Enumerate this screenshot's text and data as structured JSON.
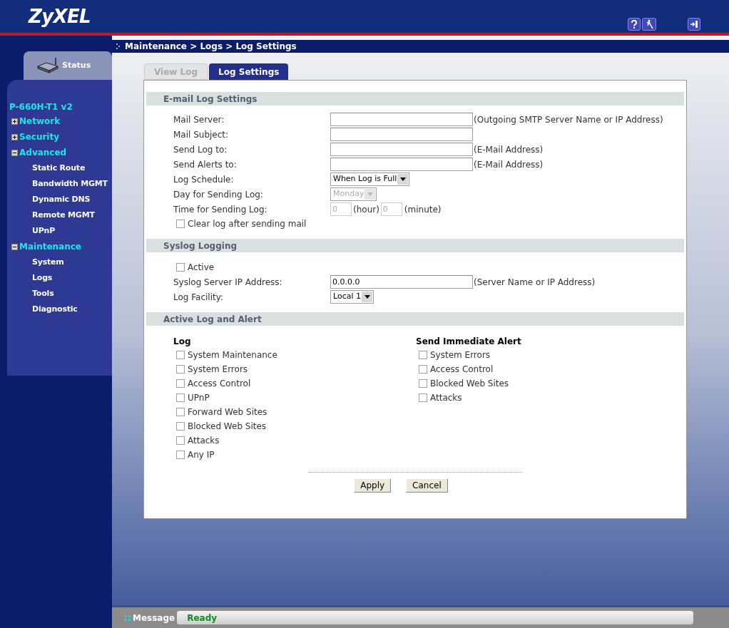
{
  "header": {
    "logo": "ZyXEL"
  },
  "breadcrumb": "Maintenance > Logs > Log Settings",
  "sidebar": {
    "status_tab": "Status",
    "device": "P-660H-T1 v2",
    "items": [
      {
        "label": "Network",
        "expanded": false
      },
      {
        "label": "Security",
        "expanded": false
      },
      {
        "label": "Advanced",
        "expanded": true,
        "children": [
          {
            "label": "Static Route"
          },
          {
            "label": "Bandwidth MGMT"
          },
          {
            "label": "Dynamic DNS"
          },
          {
            "label": "Remote MGMT"
          },
          {
            "label": "UPnP"
          }
        ]
      },
      {
        "label": "Maintenance",
        "expanded": true,
        "children": [
          {
            "label": "System"
          },
          {
            "label": "Logs"
          },
          {
            "label": "Tools"
          },
          {
            "label": "Diagnostic"
          }
        ]
      }
    ]
  },
  "tabs": [
    {
      "label": "View Log",
      "selected": false
    },
    {
      "label": "Log Settings",
      "selected": true
    }
  ],
  "email_section": {
    "title": "E-mail Log Settings",
    "rows": [
      {
        "kind": "text",
        "label": "Mail Server:",
        "value": "",
        "hint": "(Outgoing SMTP Server Name or IP Address)"
      },
      {
        "kind": "text",
        "label": "Mail Subject:",
        "value": ""
      },
      {
        "kind": "text",
        "label": "Send Log to:",
        "value": "",
        "hint": "(E-Mail Address)"
      },
      {
        "kind": "text",
        "label": "Send Alerts to:",
        "value": "",
        "hint": "(E-Mail Address)"
      },
      {
        "kind": "select",
        "label": "Log Schedule:",
        "value": "When Log is Full",
        "disabled": false
      },
      {
        "kind": "select",
        "label": "Day for Sending Log:",
        "value": "Monday",
        "disabled": true
      },
      {
        "kind": "time",
        "label": "Time for Sending Log:",
        "hour": "0",
        "hour_unit": "(hour)",
        "minute": "0",
        "minute_unit": "(minute)",
        "disabled": true
      },
      {
        "kind": "checkbox",
        "label": "Clear log after sending mail",
        "checked": false
      }
    ]
  },
  "syslog_section": {
    "title": "Syslog Logging",
    "rows": [
      {
        "kind": "checkbox",
        "label": "Active",
        "checked": false
      },
      {
        "kind": "text",
        "label": "Syslog Server IP Address:",
        "value": "0.0.0.0",
        "hint": "(Server Name or IP Address)"
      },
      {
        "kind": "select",
        "label": "Log Facility:",
        "value": "Local 1",
        "disabled": false
      }
    ]
  },
  "alert_section": {
    "title": "Active Log and Alert",
    "log": {
      "title": "Log",
      "items": [
        {
          "label": "System Maintenance",
          "checked": false
        },
        {
          "label": "System Errors",
          "checked": false
        },
        {
          "label": "Access Control",
          "checked": false
        },
        {
          "label": "UPnP",
          "checked": false
        },
        {
          "label": "Forward Web Sites",
          "checked": false
        },
        {
          "label": "Blocked Web Sites",
          "checked": false
        },
        {
          "label": "Attacks",
          "checked": false
        },
        {
          "label": "Any IP",
          "checked": false
        }
      ]
    },
    "alert": {
      "title": "Send Immediate Alert",
      "items": [
        {
          "label": "System Errors",
          "checked": false
        },
        {
          "label": "Access Control",
          "checked": false
        },
        {
          "label": "Blocked Web Sites",
          "checked": false
        },
        {
          "label": "Attacks",
          "checked": false
        }
      ]
    }
  },
  "buttons": [
    "Apply",
    "Cancel"
  ],
  "status_bar": {
    "label": "Message",
    "value": "Ready"
  }
}
